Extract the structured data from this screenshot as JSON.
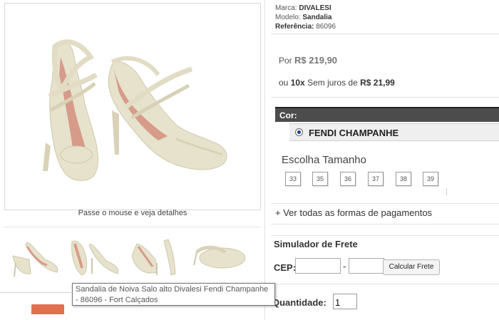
{
  "product": {
    "marca_label": "Marca:",
    "marca_value": "DIVALESI",
    "modelo_label": "Modelo:",
    "modelo_value": "Sandalia",
    "referencia_label": "Referência:",
    "referencia_value": "86096"
  },
  "price": {
    "prefix": "Por",
    "value": "R$ 219,90",
    "installments_prefix": "ou",
    "installments_count": "10x",
    "installments_text": "Sem juros de",
    "installments_value": "R$ 21,99"
  },
  "color": {
    "title": "Cor:",
    "selected": "FENDI CHAMPANHE"
  },
  "sizes": {
    "title": "Escolha Tamanho",
    "options": [
      "33",
      "35",
      "36",
      "37",
      "38",
      "39"
    ]
  },
  "gallery": {
    "hover_caption": "Passe o mouse e veja detalhes",
    "tooltip": "Sandalia de Noiva Salo alto Divalesi Fendi Champanhe - 86096 - Fort Calçados"
  },
  "payments": {
    "link": "+ Ver todas as formas de pagamentos"
  },
  "shipping": {
    "title": "Simulador de Frete",
    "cep_label": "CEP:",
    "dash": "-",
    "calculate_button": "Calcular Frete"
  },
  "quantity": {
    "label": "Quantidade:",
    "value": "1"
  },
  "colors": {
    "cor_bar": "#4c4c4c",
    "radio_selected": "#1a3d8a",
    "shoe_base": "#e6e2cc",
    "shoe_lining": "#d79b8a",
    "accent_button": "#e07050"
  }
}
